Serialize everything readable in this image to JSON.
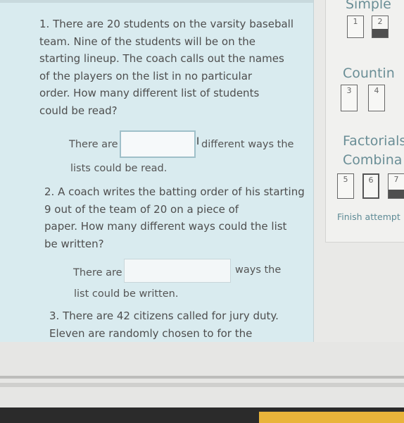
{
  "questions": [
    {
      "text": "1. There are 20 students on the varsity baseball\nteam. Nine of the students will be on the\nstarting lineup. The coach calls out the names\nof the players on the list in no particular\norder. How many different list of students\ncould be read?",
      "answer_prefix": "There are",
      "answer_suffix": "different ways the",
      "answer_continuation": "lists could be read.",
      "answer_value": ""
    },
    {
      "text": "2. A coach writes the batting order of his starting\n9 out of the team of 20 on a piece of\npaper. How many different ways could the list\nbe written?",
      "answer_prefix": "There are",
      "answer_suffix": "ways the",
      "answer_continuation": "list could be written.",
      "answer_value": ""
    },
    {
      "text": "3. There are 42 citizens called for jury duty.\nEleven are randomly chosen to for the"
    }
  ],
  "nav": {
    "sections": [
      {
        "title": "Simple",
        "boxes": [
          "1",
          "2"
        ]
      },
      {
        "title": "Countin",
        "boxes": [
          "3",
          "4"
        ]
      },
      {
        "title": "Factorials\nCombina",
        "boxes": [
          "5",
          "6",
          "7"
        ]
      }
    ],
    "finish_label": "Finish attempt ..."
  }
}
